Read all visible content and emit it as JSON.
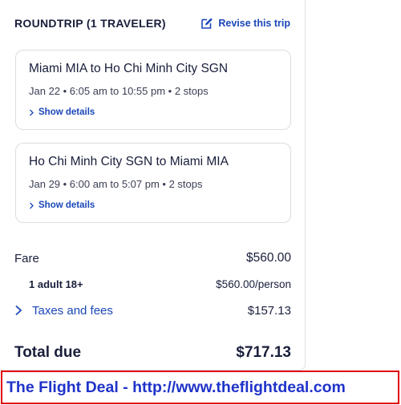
{
  "header": {
    "trip_type": "ROUNDTRIP (1 TRAVELER)",
    "revise_label": "Revise this trip"
  },
  "legs": [
    {
      "route": "Miami MIA to Ho Chi Minh City SGN",
      "times": "Jan 22 • 6:05 am to 10:55 pm • 2 stops",
      "details_label": "Show details"
    },
    {
      "route": "Ho Chi Minh City SGN to Miami MIA",
      "times": "Jan 29 • 6:00 am to 5:07 pm • 2 stops",
      "details_label": "Show details"
    }
  ],
  "pricing": {
    "fare_label": "Fare",
    "fare_amount": "$560.00",
    "adult_label": "1 adult 18+",
    "adult_amount": "$560.00/person",
    "taxes_label": "Taxes and fees",
    "taxes_amount": "$157.13",
    "total_label": "Total due",
    "total_amount": "$717.13"
  },
  "banner": {
    "text": "The Flight Deal - http://www.theflightdeal.com"
  },
  "colors": {
    "link": "#1a47b8",
    "text": "#191e3b",
    "banner_border": "#e00000",
    "banner_text": "#1f33c9"
  },
  "icons": [
    "edit-icon",
    "chevron-right-icon"
  ]
}
